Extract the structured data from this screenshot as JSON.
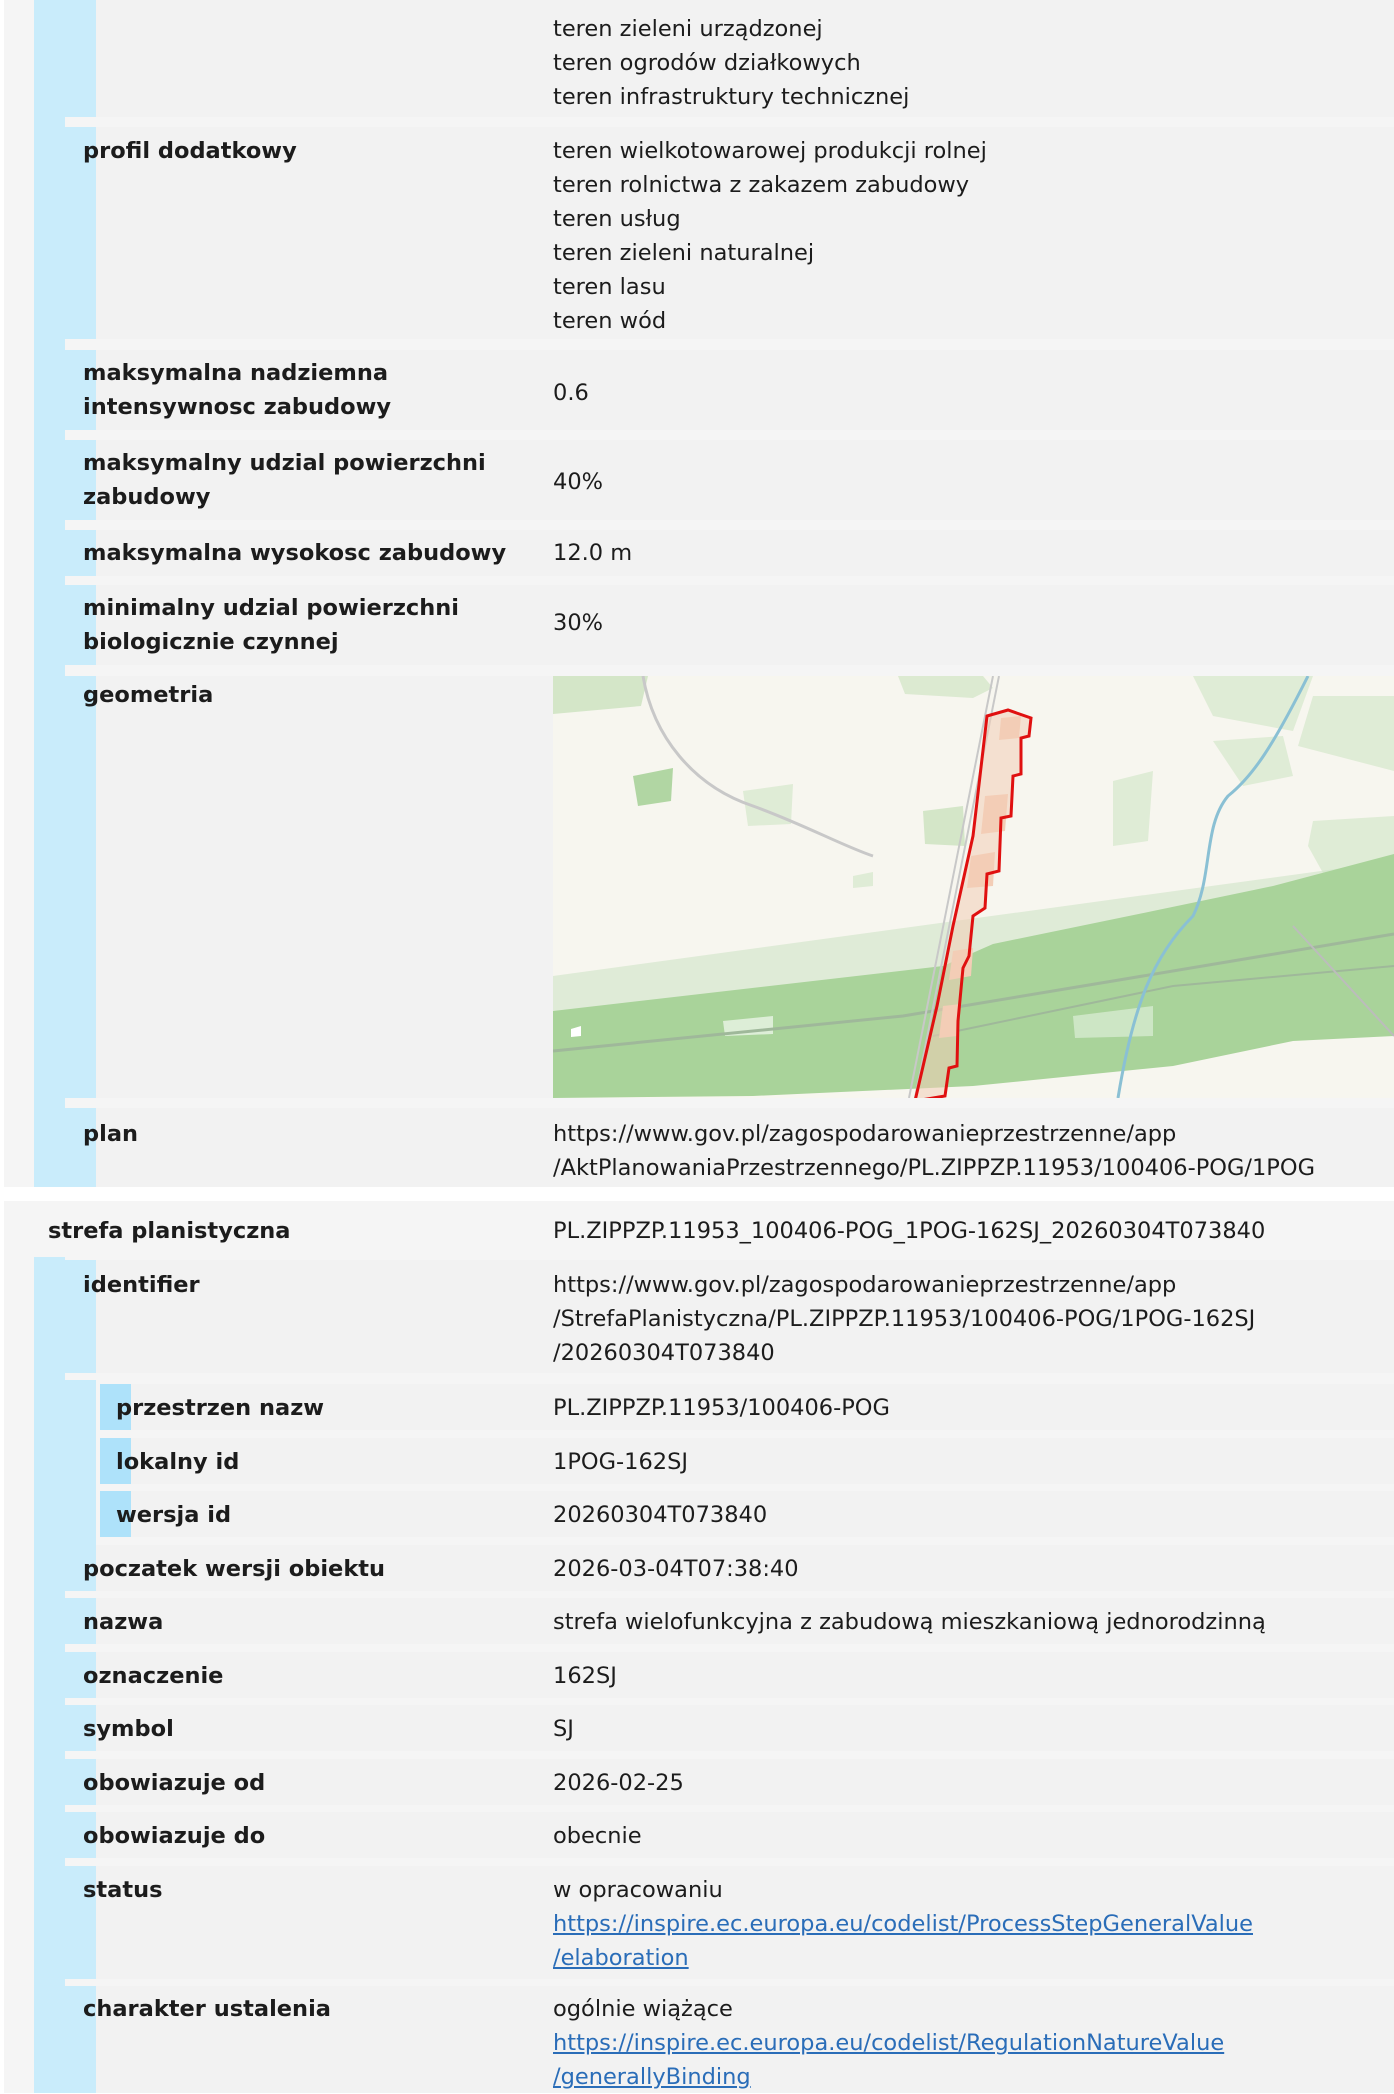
{
  "top_values": [
    "teren zieleni urządzonej",
    "teren ogrodów działkowych",
    "teren infrastruktury technicznej"
  ],
  "profil_dodatkowy": {
    "label": "profil dodatkowy",
    "values": [
      "teren wielkotowarowej produkcji rolnej",
      "teren rolnictwa z zakazem zabudowy",
      "teren usług",
      "teren zieleni naturalnej",
      "teren lasu",
      "teren wód"
    ]
  },
  "intensywnosc": {
    "label_line1": "maksymalna nadziemna",
    "label_line2": "intensywnosc zabudowy",
    "value": "0.6"
  },
  "udzial_zabudowy": {
    "label_line1": "maksymalny udzial powierzchni",
    "label_line2": "zabudowy",
    "value": "40%"
  },
  "wysokosc": {
    "label": "maksymalna wysokosc zabudowy",
    "value": "12.0 m"
  },
  "biologicznie_czynna": {
    "label_line1": "minimalny udzial powierzchni",
    "label_line2": "biologicznie czynnej",
    "value": "30%"
  },
  "geometria": {
    "label": "geometria"
  },
  "plan": {
    "label": "plan",
    "value_line1": "https://www.gov.pl/zagospodarowanieprzestrzenne/app",
    "value_line2": "/AktPlanowaniaPrzestrzennego/PL.ZIPPZP.11953/100406-POG/1POG"
  },
  "strefa": {
    "label": "strefa planistyczna",
    "value": "PL.ZIPPZP.11953_100406-POG_1POG-162SJ_20260304T073840"
  },
  "identifier": {
    "label": "identifier",
    "lines": [
      "https://www.gov.pl/zagospodarowanieprzestrzenne/app",
      "/StrefaPlanistyczna/PL.ZIPPZP.11953/100406-POG/1POG-162SJ",
      "/20260304T073840"
    ]
  },
  "przestrzen_nazw": {
    "label": "przestrzen nazw",
    "value": "PL.ZIPPZP.11953/100406-POG"
  },
  "lokalny_id": {
    "label": "lokalny id",
    "value": "1POG-162SJ"
  },
  "wersja_id": {
    "label": "wersja id",
    "value": "20260304T073840"
  },
  "poczatek_wersji": {
    "label": "poczatek wersji obiektu",
    "value": "2026-03-04T07:38:40"
  },
  "nazwa": {
    "label": "nazwa",
    "value": "strefa wielofunkcyjna z zabudową mieszkaniową jednorodzinną"
  },
  "oznaczenie": {
    "label": "oznaczenie",
    "value": "162SJ"
  },
  "symbol": {
    "label": "symbol",
    "value": "SJ"
  },
  "obowiazuje_od": {
    "label": "obowiazuje od",
    "value": "2026-02-25"
  },
  "obowiazuje_do": {
    "label": "obowiazuje do",
    "value": "obecnie"
  },
  "status": {
    "label": "status",
    "value": "w opracowaniu",
    "link_line1": "https://inspire.ec.europa.eu/codelist/ProcessStepGeneralValue",
    "link_line2": "/elaboration"
  },
  "charakter": {
    "label": "charakter ustalenia",
    "value": "ogólnie wiążące",
    "link_line1": "https://inspire.ec.europa.eu/codelist/RegulationNatureValue",
    "link_line2": "/generallyBinding"
  },
  "colors": {
    "bar_light": "#c9ecfb",
    "bar_dark": "#aee2fa",
    "row_bg": "#f2f2f2",
    "link": "#2a6db8",
    "parcel_outline": "#e01010",
    "forest": "#a9d39a"
  }
}
